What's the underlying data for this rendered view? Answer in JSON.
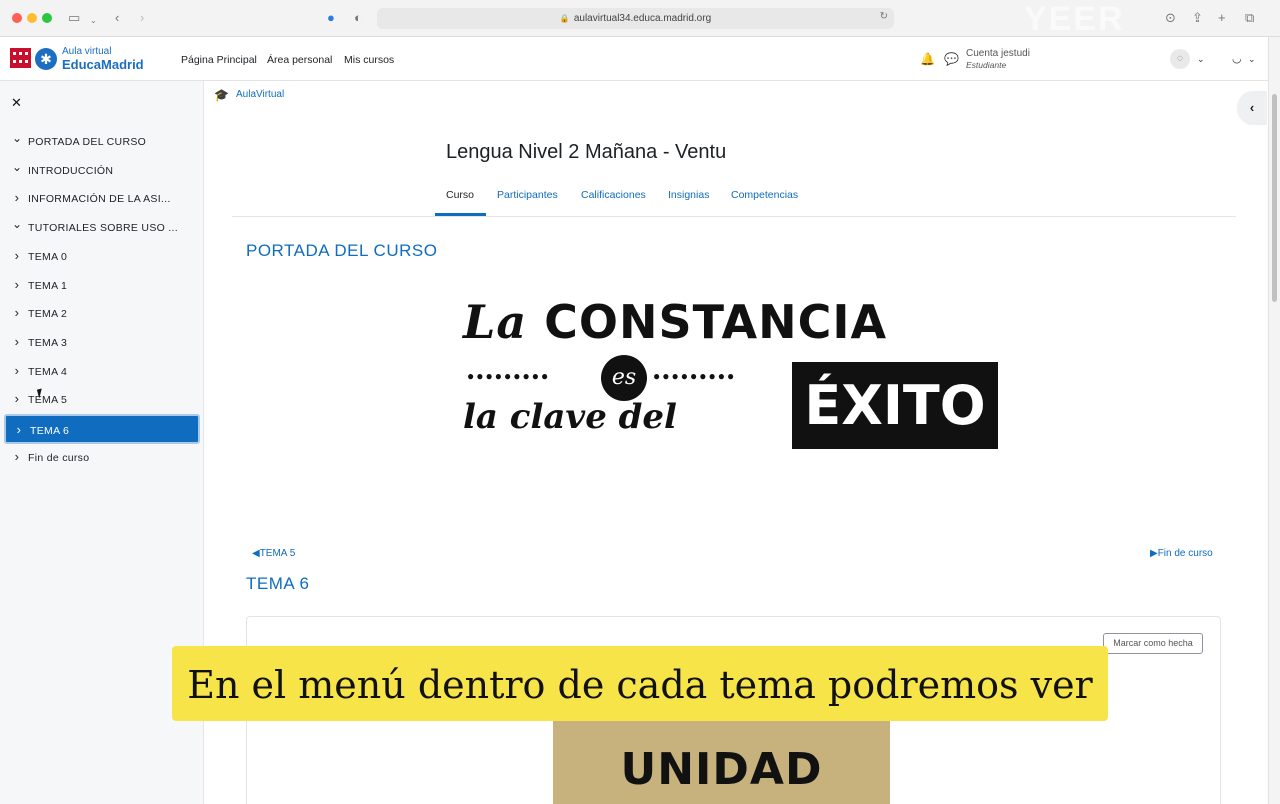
{
  "browser": {
    "url": "aulavirtual34.educa.madrid.org",
    "watermark": "YEER"
  },
  "navbar": {
    "logo_sub": "Aula virtual",
    "logo_main": "EducaMadrid",
    "links": [
      "Página Principal",
      "Área personal",
      "Mis cursos"
    ],
    "user_name": "Cuenta jestudi",
    "user_role": "Estudiante"
  },
  "drawer": {
    "sections": [
      {
        "label": "PORTADA DEL CURSO",
        "expanded": true
      },
      {
        "label": "INTRODUCCIÓN",
        "expanded": true
      },
      {
        "label": "INFORMACIÓN DE LA ASI...",
        "expanded": false
      },
      {
        "label": "TUTORIALES SOBRE USO ...",
        "expanded": true
      },
      {
        "label": "TEMA 0",
        "expanded": false
      },
      {
        "label": "TEMA 1",
        "expanded": false
      },
      {
        "label": "TEMA 2",
        "expanded": false
      },
      {
        "label": "TEMA 3",
        "expanded": false
      },
      {
        "label": "TEMA 4",
        "expanded": false
      },
      {
        "label": "TEMA 5",
        "expanded": false
      },
      {
        "label": "TEMA 6",
        "expanded": false,
        "active": true
      },
      {
        "label": "Fin de curso",
        "expanded": false
      }
    ]
  },
  "main": {
    "breadcrumb": "AulaVirtual",
    "course_title": "Lengua Nivel 2 Mañana - Ventu",
    "tabs": [
      "Curso",
      "Participantes",
      "Calificaciones",
      "Insignias",
      "Competencias"
    ],
    "section1_title": "PORTADA DEL CURSO",
    "banner": {
      "line1_script": "La",
      "line1_bold": "CONSTANCIA",
      "es": "es",
      "line2": "la clave del",
      "exito": "ÉXITO"
    },
    "prev_link": "TEMA 5",
    "next_link": "Fin de curso",
    "section2_title": "TEMA 6",
    "mark_done": "Marcar como hecha",
    "unidad": "UNIDAD"
  },
  "subtitle": "En el menú dentro de cada tema podremos ver",
  "colors": {
    "accent": "#0f6cbf",
    "subtitle_bg": "#f6e449",
    "drawer_bg": "#f5f7f9"
  }
}
